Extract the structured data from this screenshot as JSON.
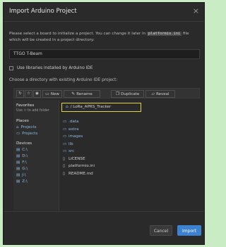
{
  "dialog": {
    "title": "Import Arduino Project",
    "close_glyph": "×",
    "intro_before": "Please select a board to initialize a project. You can change it later in ",
    "intro_code": "platformio.ini",
    "intro_after": " file which will be created in a project directory:",
    "board_value": "TTGO T-Beam",
    "use_libraries_label": "Use libraries installed by Arduino IDE",
    "use_libraries_checked": false,
    "choose_label": "Choose a directory with existing Arduino IDE project:"
  },
  "toolbar": {
    "new_label": "New",
    "rename_label": "Rename",
    "duplicate_label": "Duplicate",
    "reveal_label": "Reveal"
  },
  "sidebar": {
    "favorites_header": "Favorites",
    "favorites_hint": "Use ✩ to add folder",
    "places_header": "Places",
    "places": [
      "Projects",
      "Projects"
    ],
    "devices_header": "Devices",
    "devices": [
      "C:\\",
      "D:\\",
      "F:\\",
      "G:\\",
      "J:\\",
      "Z:\\"
    ]
  },
  "path": {
    "text": "/  LoRa_APRS_Tracker"
  },
  "files": [
    {
      "name": ".data",
      "type": "folder"
    },
    {
      "name": "extra",
      "type": "folder"
    },
    {
      "name": "images",
      "type": "folder"
    },
    {
      "name": "lib",
      "type": "folder"
    },
    {
      "name": "src",
      "type": "folder"
    },
    {
      "name": "LICENSE",
      "type": "file"
    },
    {
      "name": "platformio.ini",
      "type": "file"
    },
    {
      "name": "README.md",
      "type": "file"
    }
  ],
  "footer": {
    "cancel_label": "Cancel",
    "import_label": "Import"
  },
  "colors": {
    "background": "#c9ecc4",
    "dialog": "#2a2a2a",
    "accent": "#3b83d1",
    "highlight": "#e2d640",
    "folder": "#8cb7e6"
  }
}
